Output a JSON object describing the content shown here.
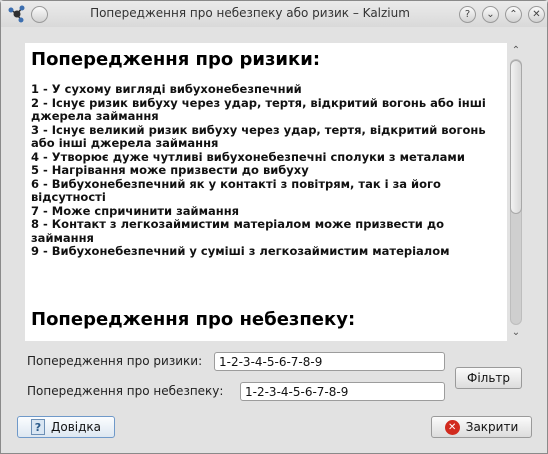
{
  "window": {
    "title": "Попередження про небезпеку або ризик – Kalzium",
    "buttons": {
      "help": "?",
      "minimize": "⌄",
      "maximize": "⌃",
      "close": "✕"
    }
  },
  "content": {
    "risk_heading": "Попередження про ризики:",
    "risks": [
      "1 - У сухому вигляді вибухонебезпечний",
      "2 - Існує ризик вибуху через удар, тертя, відкритий вогонь або інші джерела займання",
      "3 - Існує великий ризик вибуху через удар, тертя, відкритий вогонь або інші джерела займання",
      "4 - Утворює дуже чутливі вибухонебезпечні сполуки з металами",
      "5 - Нагрівання може призвести до вибуху",
      "6 - Вибухонебезпечний як у контакті з повітрям, так і за його відсутності",
      "7 - Може спричинити займання",
      "8 - Контакт з легкозаймистим матеріалом може призвести до займання",
      "9 - Вибухонебезпечний у суміші з легкозаймистим матеріалом"
    ],
    "safety_heading": "Попередження про небезпеку:"
  },
  "scrollbar": {
    "up_arrow": "⌃",
    "down_arrow": "⌄",
    "position": 0.0
  },
  "form": {
    "risk_label": "Попередження про ризики:",
    "risk_value": "1-2-3-4-5-6-7-8-9",
    "safety_label": "Попередження про небезпеку:",
    "safety_value": "1-2-3-4-5-6-7-8-9",
    "filter_button": "Фільтр"
  },
  "footer": {
    "help_button": "Довідка",
    "close_button": "Закрити"
  }
}
